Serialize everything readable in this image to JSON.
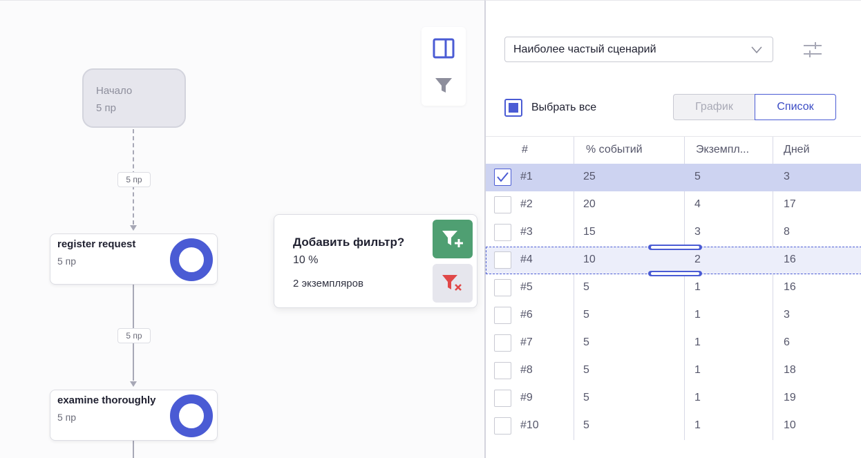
{
  "flow": {
    "start": {
      "label": "Начало",
      "count": "5 пр"
    },
    "edges": [
      {
        "label": "5 пр"
      },
      {
        "label": "5 пр"
      }
    ],
    "nodes": [
      {
        "label": "register request",
        "count": "5 пр"
      },
      {
        "label": "examine thoroughly",
        "count": "5 пр"
      }
    ]
  },
  "toolbar": {
    "icons": [
      "panel-layout-icon",
      "filter-icon"
    ]
  },
  "popover": {
    "title": "Добавить фильтр?",
    "percent": "10 %",
    "instances": "2 экземпляров",
    "icons": [
      "filter-add-icon",
      "filter-remove-icon"
    ]
  },
  "panel": {
    "scenario_select": {
      "value": "Наиболее частый сценарий"
    },
    "select_all_label": "Выбрать все",
    "view_toggle": {
      "graph": "График",
      "list": "Список"
    },
    "table": {
      "headers": [
        "#",
        "% событий",
        "Экземпл...",
        "Дней"
      ],
      "rows": [
        {
          "id": "#1",
          "events": "25",
          "instances": "5",
          "days": "3"
        },
        {
          "id": "#2",
          "events": "20",
          "instances": "4",
          "days": "17"
        },
        {
          "id": "#3",
          "events": "15",
          "instances": "3",
          "days": "8"
        },
        {
          "id": "#4",
          "events": "10",
          "instances": "2",
          "days": "16"
        },
        {
          "id": "#5",
          "events": "5",
          "instances": "1",
          "days": "16"
        },
        {
          "id": "#6",
          "events": "5",
          "instances": "1",
          "days": "3"
        },
        {
          "id": "#7",
          "events": "5",
          "instances": "1",
          "days": "6"
        },
        {
          "id": "#8",
          "events": "5",
          "instances": "1",
          "days": "18"
        },
        {
          "id": "#9",
          "events": "5",
          "instances": "1",
          "days": "19"
        },
        {
          "id": "#10",
          "events": "5",
          "instances": "1",
          "days": "10"
        }
      ]
    }
  },
  "colors": {
    "accent": "#4a5bd4",
    "add_filter": "#4f9f72",
    "remove_filter": "#e04848",
    "selected_row": "#cdd3f1"
  }
}
